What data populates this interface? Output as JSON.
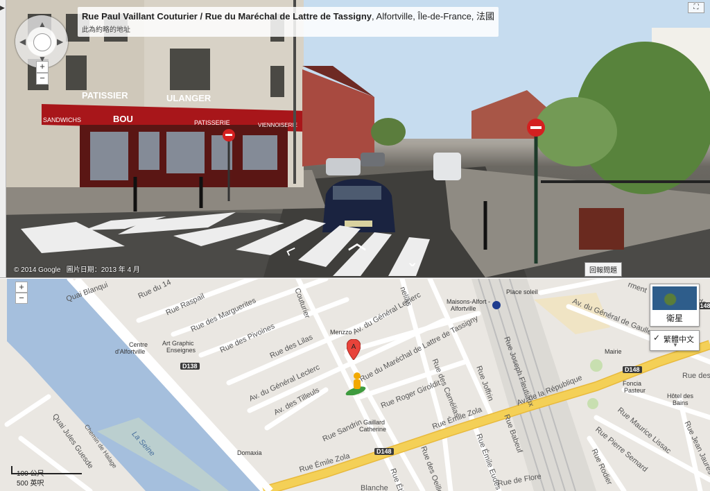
{
  "street_view": {
    "title_street": "Rue Paul Vaillant Couturier / Rue du Maréchal de Lattre de Tassigny",
    "title_place": ", Alfortville, Île-de-France, 法國",
    "subtitle": "此為約略的地址",
    "copyright": "© 2014 Google",
    "image_date": "圖片日期：2013 年 4 月",
    "report_button": "回報問題",
    "collapse_icon": "▶",
    "expand_icon": "⛶",
    "zoom_in": "+",
    "zoom_out": "−",
    "storefront_signs": [
      "PATISSIER",
      "SANDWICHS",
      "BOU",
      "PATISSERIE",
      "VIENNOISERIE",
      "ULANGER"
    ]
  },
  "map": {
    "zoom_in": "+",
    "zoom_out": "−",
    "satellite_label": "衛星",
    "language_label": "繁體中文",
    "language_check": "✓",
    "language_arrow": "▼",
    "marker_label": "A",
    "scale": {
      "metric": "100 公尺",
      "imperial": "500 英呎"
    },
    "road_shields": [
      "D138",
      "D148",
      "D148",
      "D148"
    ],
    "streets": [
      "Quai Blanqui",
      "Rue du 14",
      "Rue Raspail",
      "Rue des Marguerites",
      "Rue des Pivoines",
      "Rue des Lilas",
      "Av. du Général Leclerc",
      "Av. du Général Leclerc",
      "Av. des Tilleuls",
      "Rue du Maréchal de Lattre de Tassigny",
      "Rue Roger Giroldit",
      "Rue des Camélias",
      "Rue Joffrin",
      "Rue Joseph Fleutiaux",
      "Av. du Général de Gaulle",
      "Av. de la République",
      "Rue Émile Zola",
      "Rue Émile Zola",
      "Quai Jules Guesde",
      "Chemin de Halage",
      "Rue Sandrin",
      "Rue Étienne",
      "Rue des Oeillets",
      "Rue Émile Eudes",
      "Rue Babeuf",
      "Rue de Flore",
      "Rue Maurice Lissac",
      "Rue Pierre Semard",
      "Rue Rodier",
      "Rue Jean Jaurès",
      "Rue des",
      "Rue de la",
      "Blanche",
      "Couturier",
      "nelias",
      "rment"
    ],
    "pois": [
      "Centre",
      "d'Alfortville",
      "Art Graphic",
      "Enseignes",
      "Menzzo",
      "Maisons-Alfort -",
      "Alfortville",
      "Place soleil",
      "Mairie",
      "Foncia",
      "Pasteur",
      "Hôtel des",
      "Bains",
      "Gaillard",
      "Catherine",
      "Domaxia"
    ],
    "water": "La Seine",
    "colors": {
      "river": "#a5bfdd",
      "major_road": "#f4d057",
      "minor_road": "#ffffff",
      "land": "#eae7e2",
      "rail": "#bdbdbd",
      "park": "#c8dfb0"
    }
  }
}
